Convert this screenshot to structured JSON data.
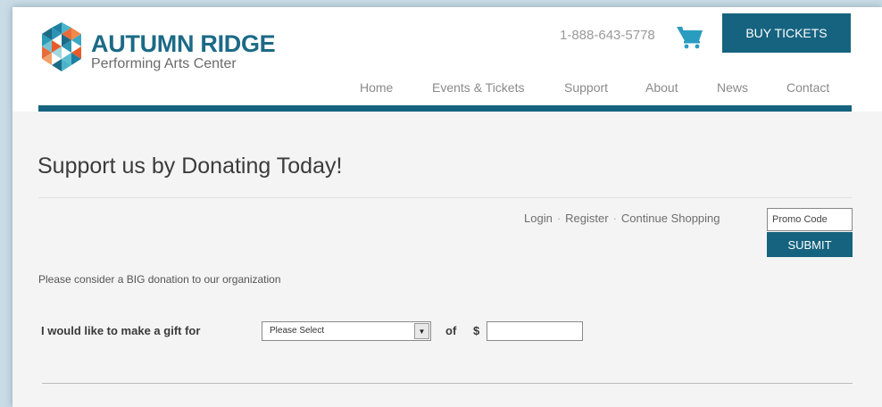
{
  "brand": {
    "title": "AUTUMN RIDGE",
    "subtitle": "Performing Arts Center",
    "primary_color": "#16637f"
  },
  "header": {
    "phone": "1-888-643-5778",
    "cart_icon": "shopping-cart-icon",
    "buy_tickets_label": "BUY TICKETS"
  },
  "nav": {
    "items": [
      {
        "label": "Home"
      },
      {
        "label": "Events & Tickets"
      },
      {
        "label": "Support"
      },
      {
        "label": "About"
      },
      {
        "label": "News"
      },
      {
        "label": "Contact"
      }
    ]
  },
  "main": {
    "page_title": "Support us by Donating Today!",
    "account_links": {
      "login": "Login",
      "register": "Register",
      "continue_shopping": "Continue Shopping",
      "separator": "·"
    },
    "promo": {
      "placeholder": "Promo Code",
      "submit_label": "SUBMIT"
    },
    "intro_text": "Please consider a BIG donation to our organization",
    "gift_form": {
      "label": "I would like to make a gift for",
      "select_value": "Please Select",
      "of_label": "of",
      "currency_label": "$",
      "amount_value": ""
    }
  }
}
